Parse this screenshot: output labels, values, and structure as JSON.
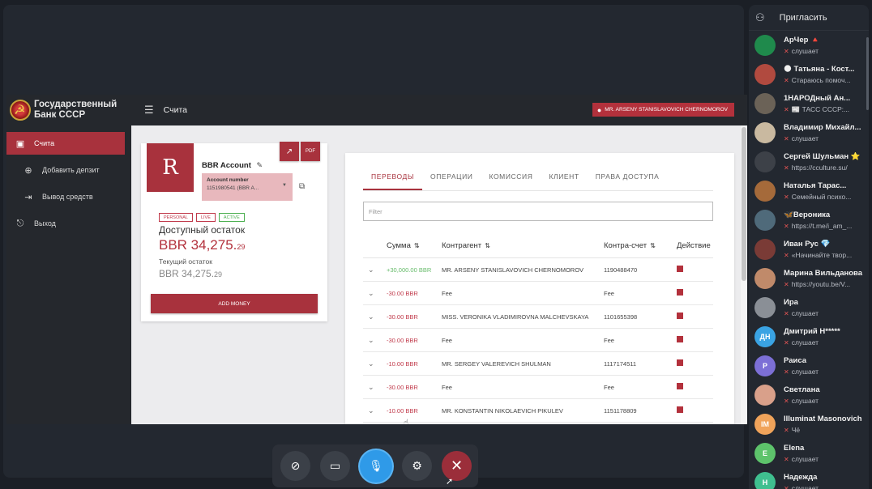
{
  "bank": {
    "logo_line1": "Государственный",
    "logo_line2": "Банк СССР",
    "page_title": "Счита",
    "user": "MR. ARSENY STANISLAVOVICH CHERNOMOROV",
    "nav": [
      {
        "label": "Счита",
        "icon": "account-icon"
      },
      {
        "label": "Добавить депзит",
        "icon": "plus-circle-icon"
      },
      {
        "label": "Вывод средств",
        "icon": "withdraw-icon"
      },
      {
        "label": "Выход",
        "icon": "exit-icon"
      }
    ]
  },
  "account": {
    "avatar_letter": "R",
    "name": "BBR Account",
    "number_label": "Account number",
    "number_value": "1151980541 (BBR A...",
    "tags": [
      "PERSONAL",
      "LIVE",
      "ACTIVE"
    ],
    "available_label": "Доступный остаток",
    "available_main": "BBR 34,275.",
    "available_cents": "29",
    "current_label": "Текущий остаток",
    "current_main": "BBR 34,275.",
    "current_cents": "29",
    "add_money": "ADD MONEY"
  },
  "transactions": {
    "tabs": [
      "ПЕРЕВОДЫ",
      "ОПЕРАЦИИ",
      "КОМИССИЯ",
      "КЛИЕНТ",
      "ПРАВА ДОСТУПА"
    ],
    "filter_placeholder": "Filter",
    "headers": {
      "sum": "Сумма",
      "counterparty": "Контрагент",
      "account": "Контра-счет",
      "action": "Действие"
    },
    "rows": [
      {
        "sum": "+30,000.00 BBR",
        "counterparty": "MR. ARSENY STANISLAVOVICH CHERNOMOROV",
        "account": "1190488470"
      },
      {
        "sum": "-30.00 BBR",
        "counterparty": "Fee",
        "account": "Fee"
      },
      {
        "sum": "-30.00 BBR",
        "counterparty": "MISS. VERONIKA VLADIMIROVNA MALCHEVSKAYA",
        "account": "1101655398"
      },
      {
        "sum": "-30.00 BBR",
        "counterparty": "Fee",
        "account": "Fee"
      },
      {
        "sum": "-10.00 BBR",
        "counterparty": "MR. SERGEY VALEREVICH SHULMAN",
        "account": "1117174511"
      },
      {
        "sum": "-30.00 BBR",
        "counterparty": "Fee",
        "account": "Fee"
      },
      {
        "sum": "-10.00 BBR",
        "counterparty": "MR. KONSTANTIN NIKOLAEVICH PIKULEV",
        "account": "1151178809"
      }
    ]
  },
  "panel": {
    "invite": "Пригласить",
    "participants": [
      {
        "name": "АрЧер 🔺",
        "status": "слушает",
        "avatar": "",
        "color": "#1f8a4c"
      },
      {
        "name": "🌑 Татьяна - Кост...",
        "status": "Стараюсь помоч...",
        "avatar": "",
        "color": "#b14a3f"
      },
      {
        "name": "1НАРОДный Ан...",
        "status": "📰 ТАСС СССР:...",
        "avatar": "",
        "color": "#6b6257"
      },
      {
        "name": "Владимир Михайл...",
        "status": "слушает",
        "avatar": "",
        "color": "#c9b9a0"
      },
      {
        "name": "Сергей Шульман ⭐",
        "status": "https://cculture.su/",
        "avatar": "",
        "color": "#3d4148"
      },
      {
        "name": "Наталья Тарас...",
        "status": "Семейный психо...",
        "avatar": "",
        "color": "#a56a3a"
      },
      {
        "name": "🦋Вероника",
        "status": "https://t.me/i_am_...",
        "avatar": "",
        "color": "#4f6a7a"
      },
      {
        "name": "Иван Рус 💎",
        "status": "«Начинайте твор...",
        "avatar": "",
        "color": "#7a3b36"
      },
      {
        "name": "Марина Вильданова",
        "status": "https://youtu.be/V...",
        "avatar": "",
        "color": "#c08a6a"
      },
      {
        "name": "Ира",
        "status": "слушает",
        "avatar": "",
        "color": "#8a8f96"
      },
      {
        "name": "Дмитрий Н*****",
        "status": "слушает",
        "avatar": "ДН",
        "color": "#3aa3e3"
      },
      {
        "name": "Раиса",
        "status": "слушает",
        "avatar": "Р",
        "color": "#7c6fd6"
      },
      {
        "name": "Светлана",
        "status": "слушает",
        "avatar": "",
        "color": "#d9a08a"
      },
      {
        "name": "Illuminat Masonovich",
        "status": "Чё",
        "avatar": "IM",
        "color": "#f0a35a"
      },
      {
        "name": "Elena",
        "status": "слушает",
        "avatar": "E",
        "color": "#5dc36b"
      },
      {
        "name": "Надежда",
        "status": "слушает",
        "avatar": "Н",
        "color": "#3fbf8f"
      }
    ]
  },
  "controls": [
    {
      "icon": "camera-off-icon"
    },
    {
      "icon": "screen-share-off-icon"
    },
    {
      "icon": "mic-muted-icon"
    },
    {
      "icon": "settings-icon"
    },
    {
      "icon": "hang-up-icon"
    }
  ]
}
